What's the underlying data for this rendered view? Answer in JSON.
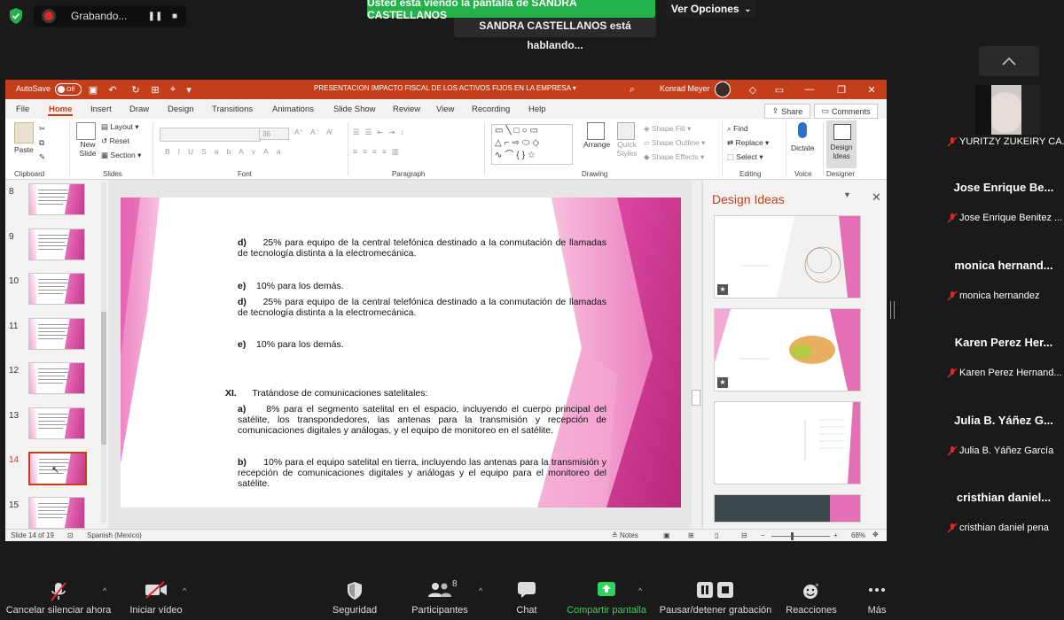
{
  "zoom": {
    "recording_label": "Grabando...",
    "viewing_banner": "Usted está viendo la pantalla de SANDRA CASTELLANOS",
    "view_options": "Ver Opciones",
    "speaking_banner": "SANDRA CASTELLANOS  está hablando...",
    "participants": [
      {
        "big": "",
        "name": "YURITZY ZUKEIRY CA..."
      },
      {
        "big": "Jose Enrique Be...",
        "name": "Jose Enrique Benitez ..."
      },
      {
        "big": "monica  hernand...",
        "name": "monica hernandez"
      },
      {
        "big": "Karen Perez Her...",
        "name": "Karen Perez Hernand..."
      },
      {
        "big": "Julia B. Yáñez G...",
        "name": "Julia B. Yáñez García"
      },
      {
        "big": "cristhian  daniel...",
        "name": "cristhian daniel pena"
      }
    ],
    "toolbar": {
      "mute": "Cancelar silenciar ahora",
      "video": "Iniciar vídeo",
      "security": "Seguridad",
      "participants": "Participantes",
      "participants_count": "8",
      "chat": "Chat",
      "share": "Compartir pantalla",
      "record": "Pausar/detener grabación",
      "reactions": "Reacciones",
      "more": "Más"
    },
    "colors": {
      "share_green": "#2fd35d",
      "banner_green": "#23b24a",
      "mic_red": "#e02828"
    }
  },
  "ppt": {
    "autosave": "AutoSave",
    "autosave_state": "Off",
    "doc_title": "PRESENTACION IMPACTO FISCAL DE LOS ACTIVOS FIJOS EN LA EMPRESA  ▾",
    "user": "Konrad Meyer",
    "tabs": [
      "File",
      "Home",
      "Insert",
      "Draw",
      "Design",
      "Transitions",
      "Animations",
      "Slide Show",
      "Review",
      "View",
      "Recording",
      "Help"
    ],
    "active_tab": "Home",
    "share": "Share",
    "comments": "Comments",
    "ribbon": {
      "paste": "Paste",
      "clipboard": "Clipboard",
      "new_slide": "New Slide",
      "layout": "Layout",
      "reset": "Reset",
      "section": "Section",
      "slides": "Slides",
      "font_size": "36",
      "font": "Font",
      "paragraph": "Paragraph",
      "arrange": "Arrange",
      "quick_styles": "Quick Styles",
      "shape_fill": "Shape Fill",
      "shape_outline": "Shape Outline",
      "shape_effects": "Shape Effects",
      "drawing": "Drawing",
      "find": "Find",
      "replace": "Replace",
      "select": "Select",
      "editing": "Editing",
      "dictate": "Dictate",
      "voice": "Voice",
      "design_ideas": "Design Ideas",
      "designer": "Designer"
    },
    "thumb_numbers": [
      "8",
      "9",
      "10",
      "11",
      "12",
      "13",
      "14",
      "15"
    ],
    "active_slide": "14",
    "slide": {
      "p1_letter": "d)",
      "p1_text": "25% para equipo de la central telefónica destinado a la conmutación de llamadas de tecnología distinta a la electromecánica.",
      "p2_letter": "e)",
      "p2_text": "10% para los demás.",
      "p3_letter": "d)",
      "p3_text": "25% para equipo de la central telefónica destinado a la conmutación de llamadas de tecnología distinta a la electromecánica.",
      "p4_letter": "e)",
      "p4_text": "10% para los demás.",
      "xi_num": "XI.",
      "xi_text": "Tratándose de comunicaciones satelitales:",
      "a_letter": "a)",
      "a_text": "8% para el segmento satelital en el espacio, incluyendo el cuerpo principal del satélite, los transpondedores, las antenas para la transmisión y recepción de comunicaciones digitales y análogas, y el equipo de monitoreo en el satélite.",
      "b_letter": "b)",
      "b_text": "10% para el equipo satelital en tierra, incluyendo las antenas para la transmisión y recepción de comunicaciones digitales y análogas y el equipo para el monitoreo del satélite."
    },
    "design_pane_title": "Design Ideas",
    "status": {
      "slide_count": "Slide 14 of 19",
      "language": "Spanish (Mexico)",
      "notes": "Notes",
      "zoom": "68%"
    },
    "colors": {
      "accent": "#c43e1c",
      "slide_pink": "#e04ea6"
    }
  }
}
